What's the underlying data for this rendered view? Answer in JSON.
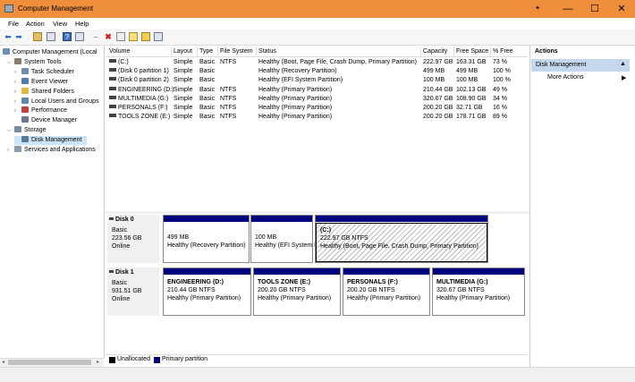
{
  "window": {
    "title": "Computer Management"
  },
  "menu": [
    "File",
    "Action",
    "View",
    "Help"
  ],
  "tree": [
    {
      "label": "Computer Management (Local",
      "level": 0,
      "arrow": "",
      "icon": "computer-icon",
      "color": "#6b8fb5"
    },
    {
      "label": "System Tools",
      "level": 1,
      "arrow": "v",
      "icon": "tools-icon",
      "color": "#8a7f6a"
    },
    {
      "label": "Task Scheduler",
      "level": 2,
      "arrow": ">",
      "icon": "clock-icon",
      "color": "#6f8fa8"
    },
    {
      "label": "Event Viewer",
      "level": 2,
      "arrow": ">",
      "icon": "event-viewer-icon",
      "color": "#4f7fa8"
    },
    {
      "label": "Shared Folders",
      "level": 2,
      "arrow": ">",
      "icon": "folder-icon",
      "color": "#e0b840"
    },
    {
      "label": "Local Users and Groups",
      "level": 2,
      "arrow": ">",
      "icon": "users-icon",
      "color": "#5a8ab0"
    },
    {
      "label": "Performance",
      "level": 2,
      "arrow": ">",
      "icon": "performance-icon",
      "color": "#c04040"
    },
    {
      "label": "Device Manager",
      "level": 2,
      "arrow": "",
      "icon": "device-manager-icon",
      "color": "#6a7a8a"
    },
    {
      "label": "Storage",
      "level": 1,
      "arrow": "v",
      "icon": "storage-icon",
      "color": "#7a8a9a"
    },
    {
      "label": "Disk Management",
      "level": 2,
      "arrow": "",
      "icon": "disk-icon",
      "color": "#5a7a9a",
      "selected": true
    },
    {
      "label": "Services and Applications",
      "level": 1,
      "arrow": ">",
      "icon": "services-icon",
      "color": "#8a9aaa"
    }
  ],
  "columns": [
    "Volume",
    "Layout",
    "Type",
    "File System",
    "Status",
    "Capacity",
    "Free Space",
    "% Free"
  ],
  "volumes": [
    [
      "(C:)",
      "Simple",
      "Basic",
      "NTFS",
      "Healthy (Boot, Page File, Crash Dump, Primary Partition)",
      "222.97 GB",
      "163.31 GB",
      "73 %"
    ],
    [
      "(Disk 0 partition 1)",
      "Simple",
      "Basic",
      "",
      "Healthy (Recovery Partition)",
      "499 MB",
      "499 MB",
      "100 %"
    ],
    [
      "(Disk 0 partition 2)",
      "Simple",
      "Basic",
      "",
      "Healthy (EFI System Partition)",
      "100 MB",
      "100 MB",
      "100 %"
    ],
    [
      "ENGINEERING (D:)",
      "Simple",
      "Basic",
      "NTFS",
      "Healthy (Primary Partition)",
      "210.44 GB",
      "102.13 GB",
      "49 %"
    ],
    [
      "MULTIMEDIA (G:)",
      "Simple",
      "Basic",
      "NTFS",
      "Healthy (Primary Partition)",
      "320.67 GB",
      "108.90 GB",
      "34 %"
    ],
    [
      "PERSONALS (F:)",
      "Simple",
      "Basic",
      "NTFS",
      "Healthy (Primary Partition)",
      "200.20 GB",
      "32.71 GB",
      "16 %"
    ],
    [
      "TOOLS ZONE (E:)",
      "Simple",
      "Basic",
      "NTFS",
      "Healthy (Primary Partition)",
      "200.20 GB",
      "178.71 GB",
      "89 %"
    ]
  ],
  "disks": [
    {
      "name": "Disk 0",
      "type": "Basic",
      "size": "223.56 GB",
      "status": "Online",
      "partitions": [
        {
          "name": "",
          "size": "499 MB",
          "status": "Healthy (Recovery Partition)"
        },
        {
          "name": "",
          "size": "100 MB",
          "status": "Healthy (EFI System Partition)"
        },
        {
          "name": "(C:)",
          "size": "222.97 GB NTFS",
          "status": "Healthy (Boot, Page File, Crash Dump, Primary Partition)",
          "selected": true
        }
      ]
    },
    {
      "name": "Disk 1",
      "type": "Basic",
      "size": "931.51 GB",
      "status": "Online",
      "partitions": [
        {
          "name": "ENGINEERING  (D:)",
          "size": "210.44 GB NTFS",
          "status": "Healthy (Primary Partition)"
        },
        {
          "name": "TOOLS ZONE  (E:)",
          "size": "200.20 GB NTFS",
          "status": "Healthy (Primary Partition)"
        },
        {
          "name": "PERSONALS  (F:)",
          "size": "200.20 GB NTFS",
          "status": "Healthy (Primary Partition)"
        },
        {
          "name": "MULTIMEDIA  (G:)",
          "size": "320.67 GB NTFS",
          "status": "Healthy (Primary Partition)"
        }
      ]
    }
  ],
  "legend": {
    "unallocated": "Unallocated",
    "primary": "Primary partition"
  },
  "actions": {
    "title": "Actions",
    "section": "Disk Management",
    "more": "More Actions"
  },
  "colors": {
    "titlebar": "#ef8f3c",
    "primary_partition": "#00007e",
    "selection": "#c5d7ec"
  }
}
